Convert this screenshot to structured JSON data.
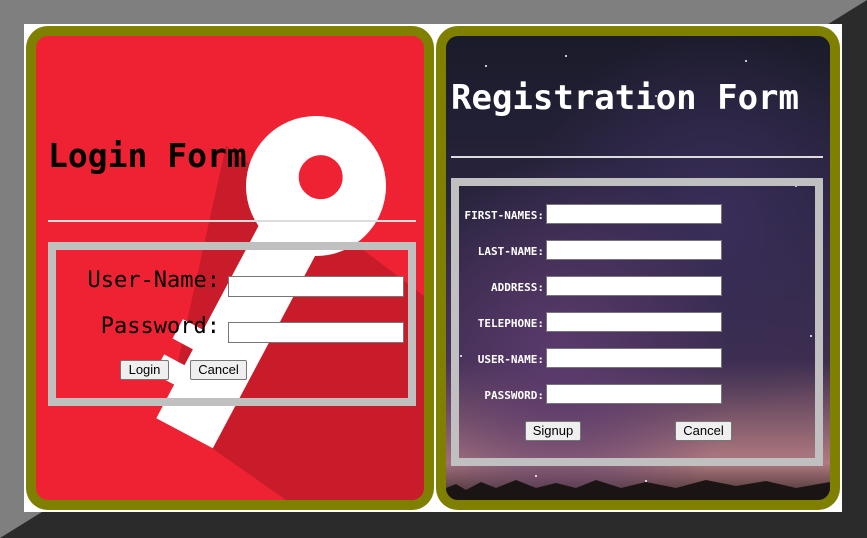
{
  "login": {
    "title": "Login Form",
    "fields": [
      {
        "label": "User-Name:",
        "value": ""
      },
      {
        "label": "Password:",
        "value": ""
      }
    ],
    "buttons": {
      "login": "Login",
      "cancel": "Cancel"
    }
  },
  "registration": {
    "title": "Registration Form",
    "fields": [
      {
        "label": "FIRST-NAMES:",
        "value": ""
      },
      {
        "label": "LAST-NAME:",
        "value": ""
      },
      {
        "label": "ADDRESS:",
        "value": ""
      },
      {
        "label": "TELEPHONE:",
        "value": ""
      },
      {
        "label": "USER-NAME:",
        "value": ""
      },
      {
        "label": "PASSWORD:",
        "value": ""
      }
    ],
    "buttons": {
      "signup": "Signup",
      "cancel": "Cancel"
    }
  },
  "colors": {
    "login_background": "#ee2233",
    "panel_border": "#808000",
    "form_box_border": "#c0c0c0"
  },
  "icons": {
    "login_background": "key-icon",
    "registration_background": "starry-sky-image"
  }
}
